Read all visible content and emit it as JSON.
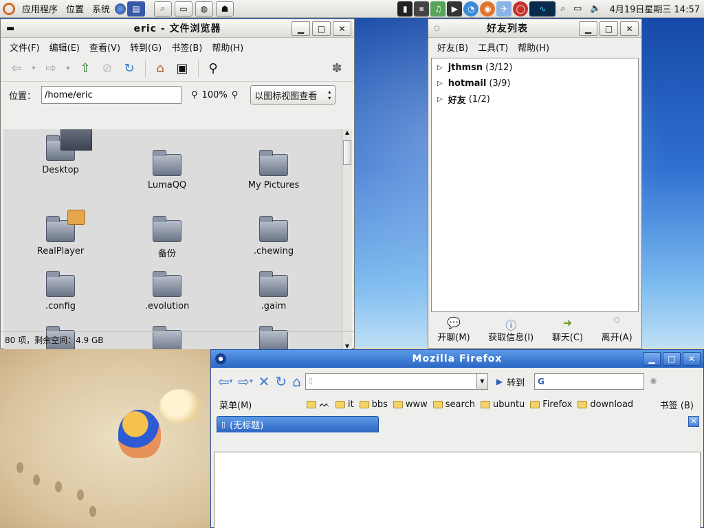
{
  "panel": {
    "applications": "应用程序",
    "places": "位置",
    "system": "系统",
    "date_time": "4月19日星期三 14:57"
  },
  "file_browser": {
    "title": "eric - 文件浏览器",
    "menu": [
      "文件(F)",
      "编辑(E)",
      "查看(V)",
      "转到(G)",
      "书签(B)",
      "帮助(H)"
    ],
    "location_label": "位置：",
    "location_value": "/home/eric",
    "zoom": "100%",
    "view_mode": "以图标视图查看",
    "items": [
      "Desktop",
      "LumaQQ",
      "My Pictures",
      "RealPlayer",
      "备份",
      ".chewing",
      ".config",
      ".evolution",
      ".gaim"
    ],
    "status": "80 项，剩余空间：4.9 GB"
  },
  "buddy_list": {
    "title": "好友列表",
    "menu": [
      "好友(B)",
      "工具(T)",
      "帮助(H)"
    ],
    "groups": [
      {
        "name": "jthmsn",
        "count": "(3/12)"
      },
      {
        "name": "hotmail",
        "count": "(3/9)"
      },
      {
        "name": "好友",
        "count": "(1/2)"
      }
    ],
    "actions": [
      "开聊(M)",
      "获取信息(I)",
      "聊天(C)",
      "离开(A)"
    ]
  },
  "firefox": {
    "title": "Mozilla Firefox",
    "go_label": "转到",
    "menu_label": "菜单(M)",
    "bookmarks": [
      "",
      "it",
      "bbs",
      "www",
      "search",
      "ubuntu",
      "Firefox",
      "download"
    ],
    "bookmarks_label": "书签 (B)",
    "tab_title": "(无标题)"
  }
}
